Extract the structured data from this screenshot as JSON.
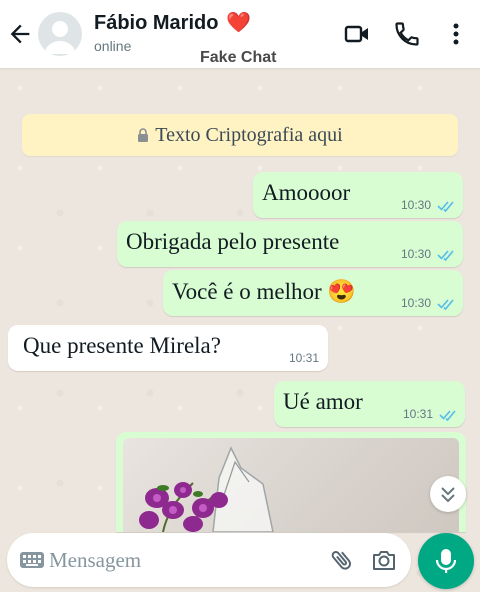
{
  "header": {
    "contact_name": "Fábio Marido",
    "heart_emoji": "❤️",
    "status": "online",
    "watermark": "Fake Chat",
    "icons": [
      "back-arrow-icon",
      "video-call-icon",
      "phone-icon",
      "more-vert-icon"
    ]
  },
  "banner": {
    "text": "Texto Criptografia aqui",
    "icon": "lock-icon"
  },
  "messages": [
    {
      "direction": "outgoing",
      "text": "Amoooor",
      "time": "10:30",
      "status": "read"
    },
    {
      "direction": "outgoing",
      "text": "Obrigada pelo presente",
      "time": "10:30",
      "status": "read"
    },
    {
      "direction": "outgoing",
      "text": "Você é o melhor 😍",
      "time": "10:30",
      "status": "read"
    },
    {
      "direction": "incoming",
      "text": "Que presente Mirela?",
      "time": "10:31"
    },
    {
      "direction": "outgoing",
      "text": "Ué amor",
      "time": "10:31",
      "status": "read"
    },
    {
      "direction": "outgoing",
      "type": "image",
      "description_icon": "orchid-photo"
    }
  ],
  "composer": {
    "placeholder": "Mensagem",
    "icons": [
      "keyboard-icon",
      "attach-icon",
      "camera-icon",
      "mic-icon"
    ]
  },
  "colors": {
    "outgoing_bubble": "#d9fdd3",
    "incoming_bubble": "#ffffff",
    "banner": "#fff3c4",
    "accent": "#00a884",
    "read_ticks": "#53bdeb"
  }
}
